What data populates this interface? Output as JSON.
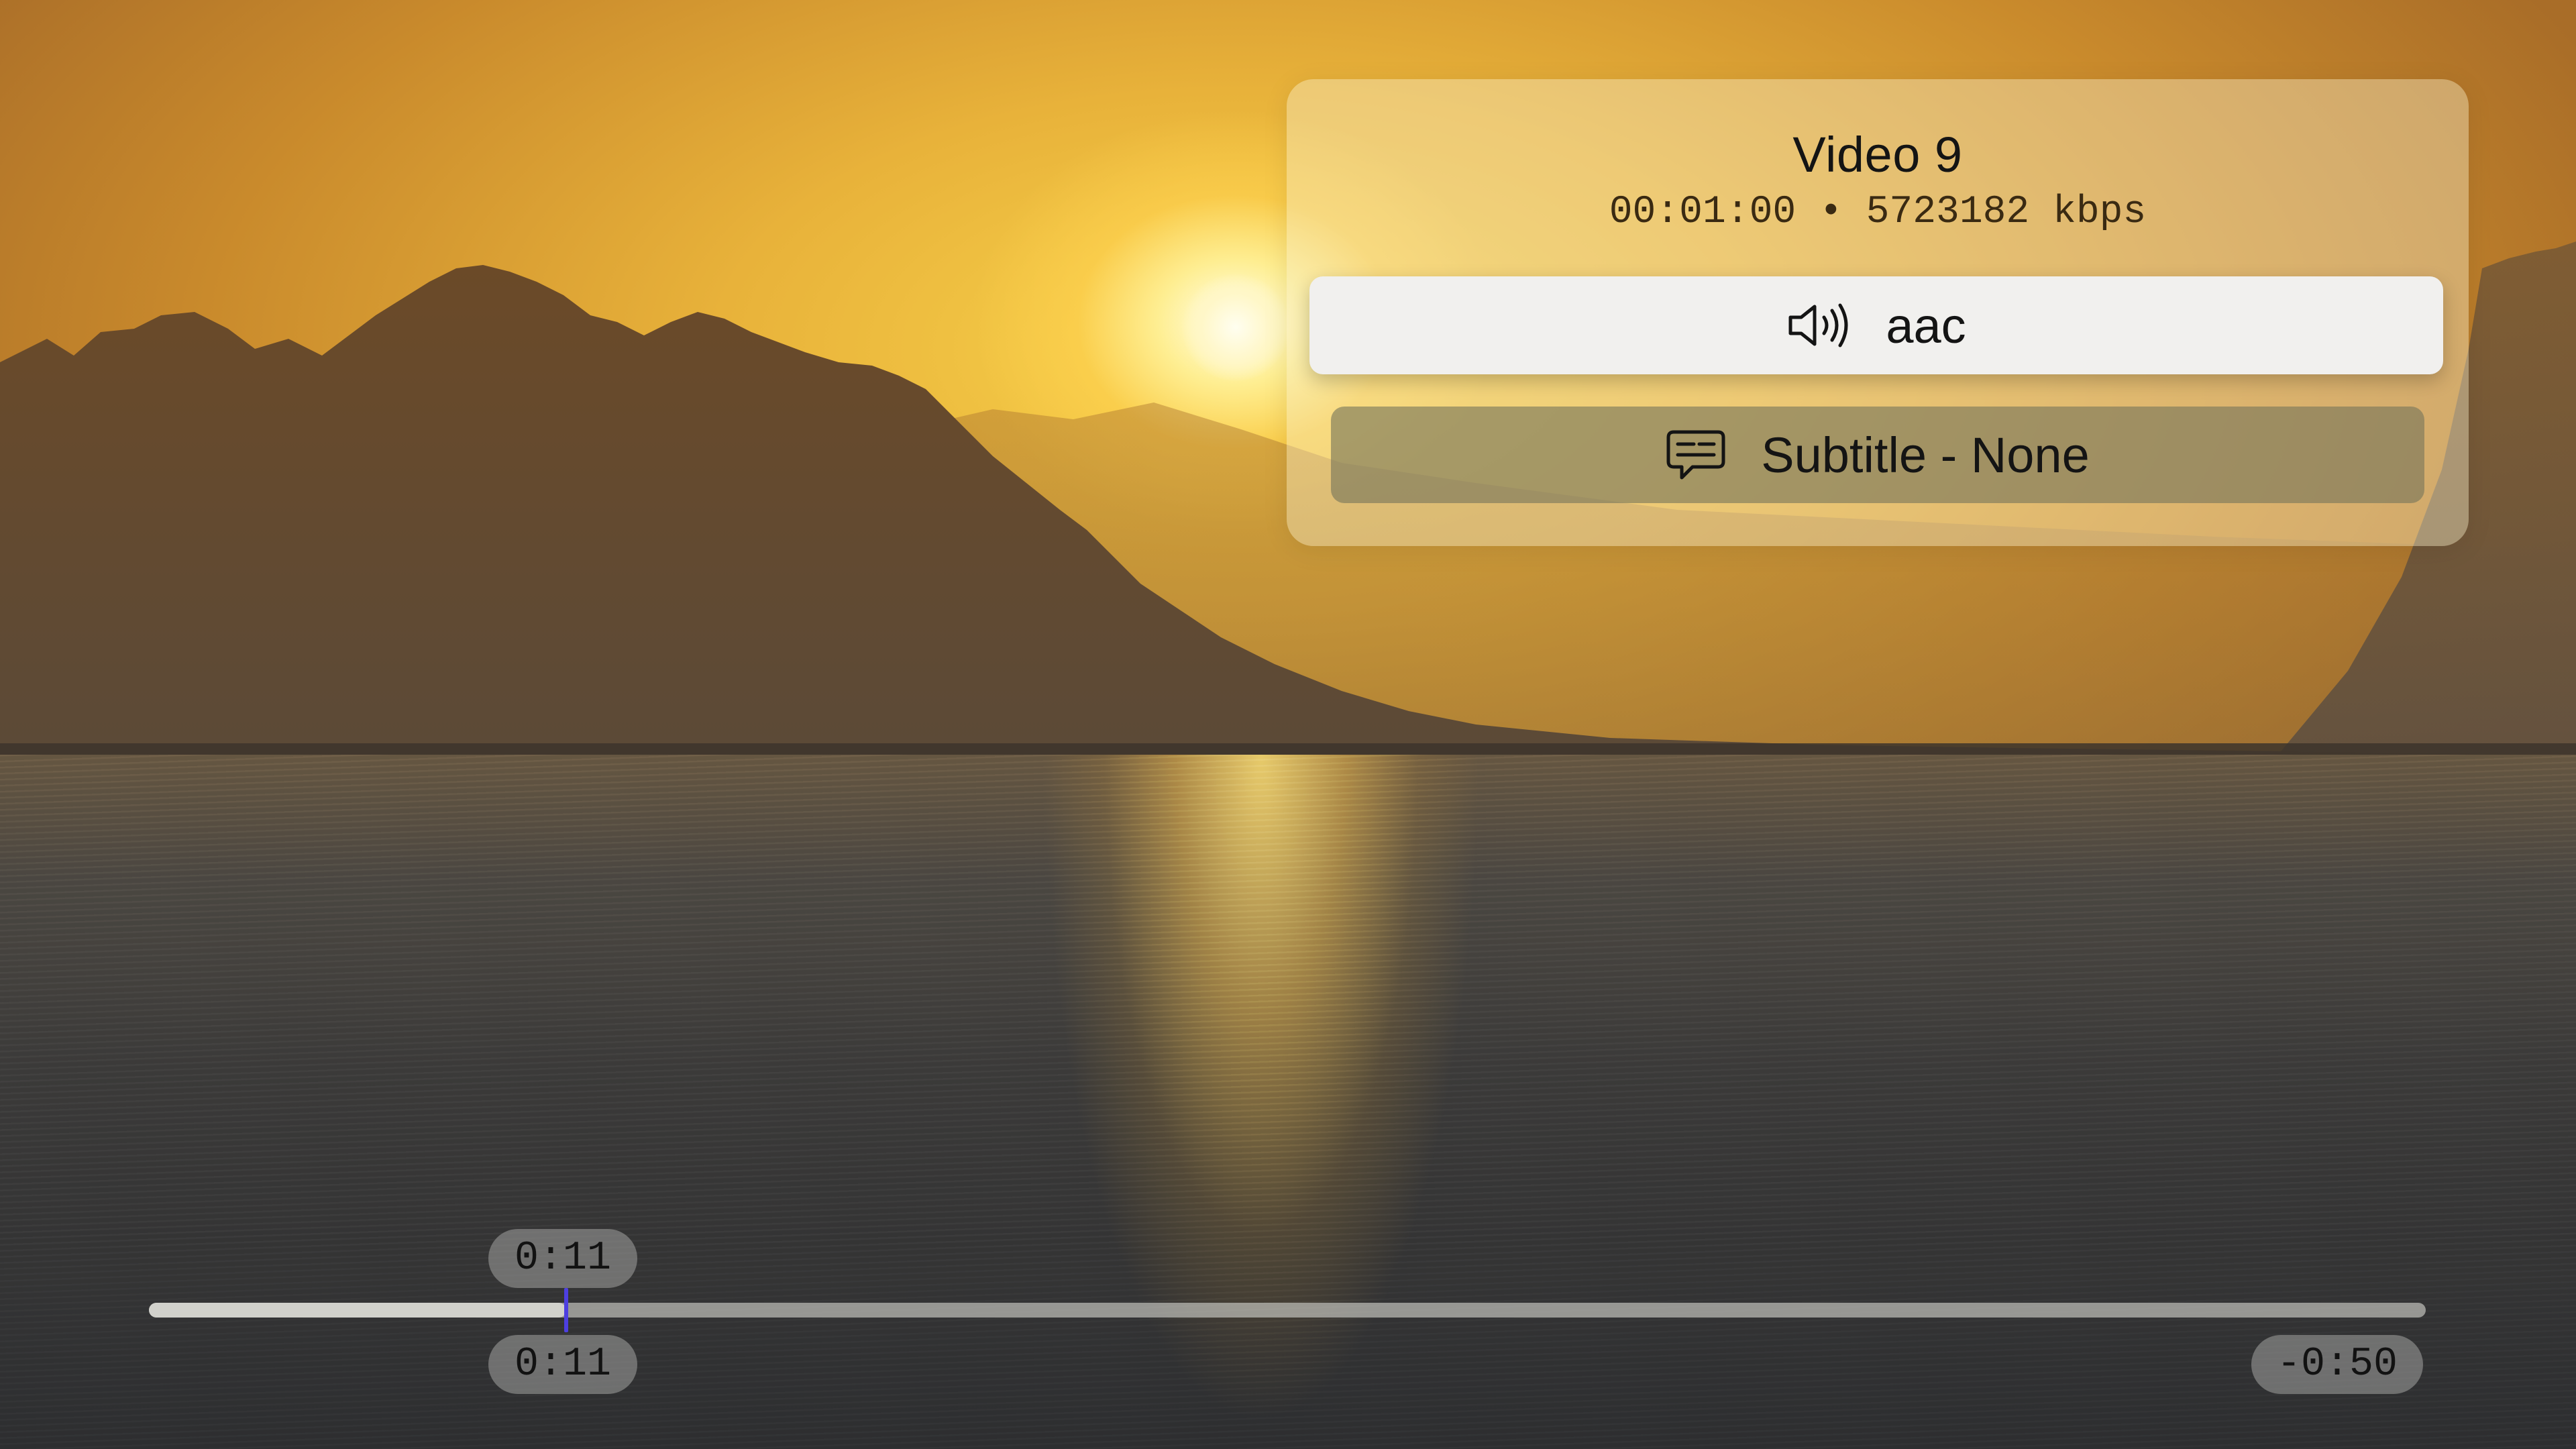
{
  "video": {
    "title": "Video 9",
    "duration": "00:01:00",
    "separator": "•",
    "bitrate": "5723182 kbps",
    "meta_line": "00:01:00 • 5723182 kbps"
  },
  "audio_track": {
    "label": "aac",
    "icon": "speaker-wave-icon",
    "selected": true
  },
  "subtitle_track": {
    "label": "Subtitle - None",
    "icon": "subtitle-bubble-icon",
    "selected": false
  },
  "playback": {
    "scrub_time": "0:11",
    "elapsed": "0:11",
    "remaining": "-0:50",
    "progress_fraction": 0.1833
  },
  "colors": {
    "playhead": "#4d3fe0",
    "selected_button_bg": "#f1f0ee",
    "panel_tint": "#f5ecc8"
  }
}
